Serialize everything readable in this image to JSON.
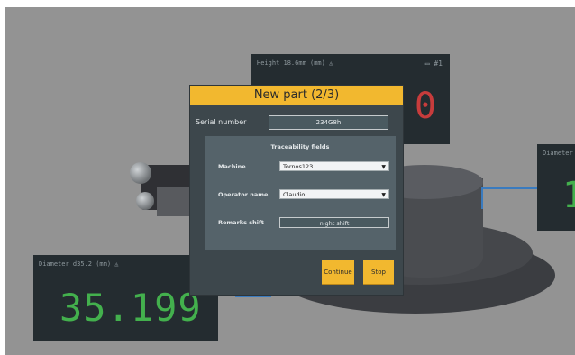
{
  "panels": {
    "height": {
      "label": "Height 18.6mm (mm)",
      "index": "#1",
      "value": "0"
    },
    "diameter_left": {
      "label": "Diameter d35.2 (mm)",
      "value": "35.199"
    },
    "diameter_right": {
      "label": "Diameter",
      "value": "1"
    }
  },
  "dialog": {
    "title": "New part (2/3)",
    "serial_label": "Serial number",
    "serial_value": "234G8h",
    "traceability_title": "Traceability fields",
    "fields": {
      "machine_label": "Machine",
      "machine_value": "Tornos123",
      "operator_label": "Operator name",
      "operator_value": "Claudio",
      "remarks_label": "Remarks shift",
      "remarks_value": "night shift"
    },
    "continue_label": "Continue",
    "stop_label": "Stop"
  },
  "colors": {
    "accent": "#f2b82f",
    "value_green": "#43b04d",
    "value_red": "#c73c3c",
    "panel_bg": "#242c30"
  }
}
